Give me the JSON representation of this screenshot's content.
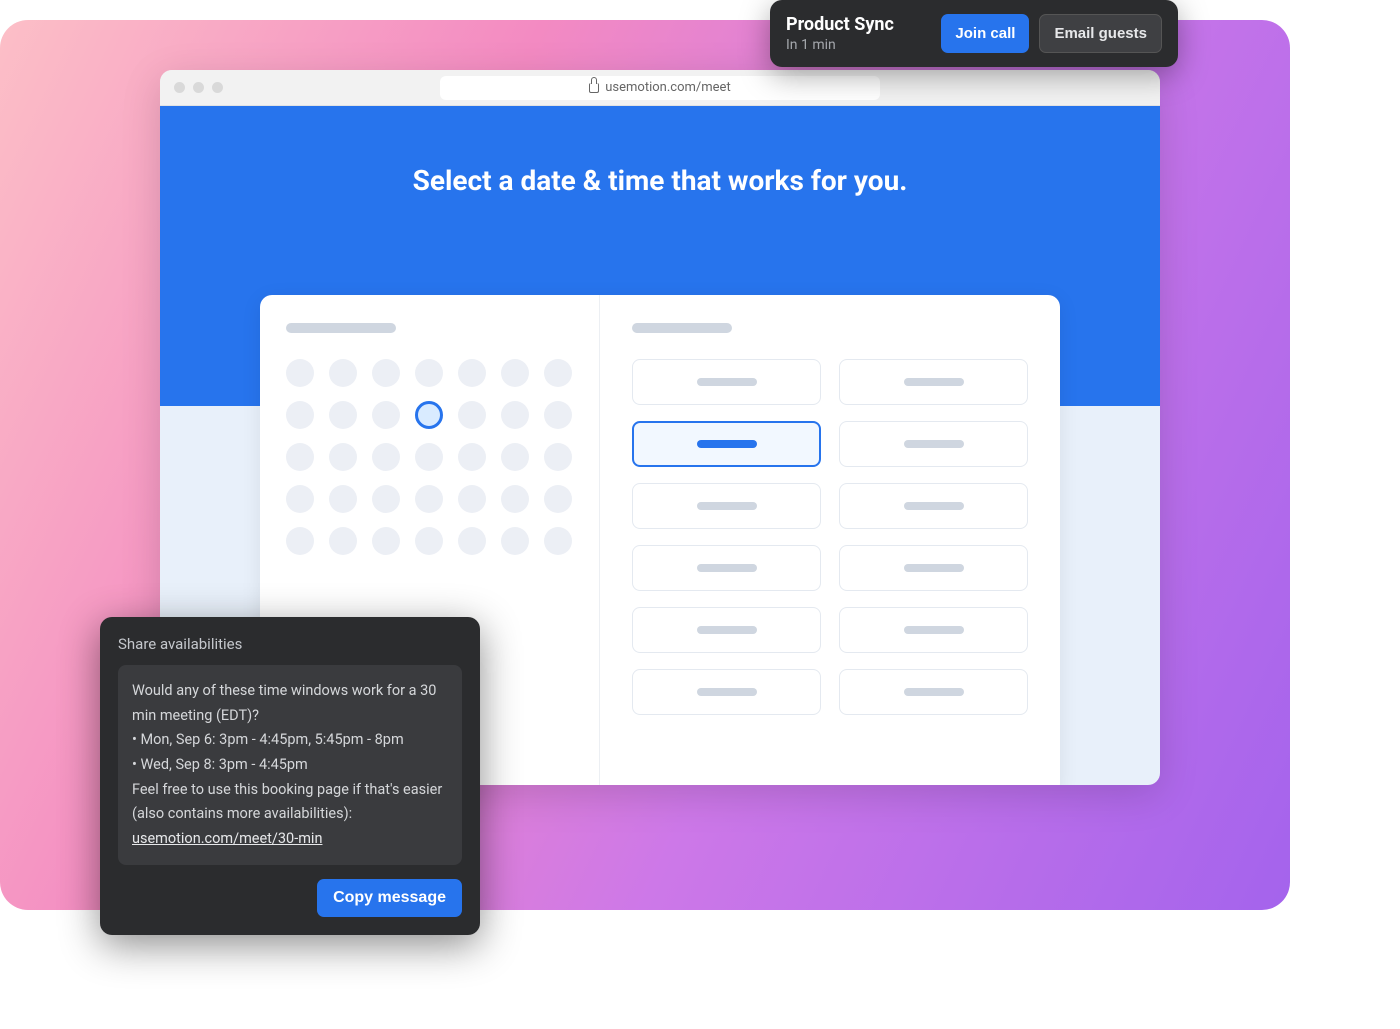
{
  "notification": {
    "title": "Product Sync",
    "subtitle": "In 1 min",
    "join_label": "Join call",
    "email_label": "Email guests"
  },
  "browser": {
    "url": "usemotion.com/meet"
  },
  "booking": {
    "headline": "Select a date & time that works for you.",
    "calendar": {
      "rows": 5,
      "cols": 7,
      "selected_index": 10
    },
    "slots": {
      "count": 12,
      "selected_index": 2
    }
  },
  "share": {
    "title": "Share availabilities",
    "intro": "Would any of these time windows work for a 30 min meeting (EDT)?",
    "line1": "• Mon, Sep 6: 3pm - 4:45pm, 5:45pm - 8pm",
    "line2": "• Wed, Sep 8: 3pm - 4:45pm",
    "outro": "Feel free to use this booking page if that's easier (also contains more availabilities):",
    "link": "usemotion.com/meet/30-min",
    "copy_label": "Copy message"
  }
}
